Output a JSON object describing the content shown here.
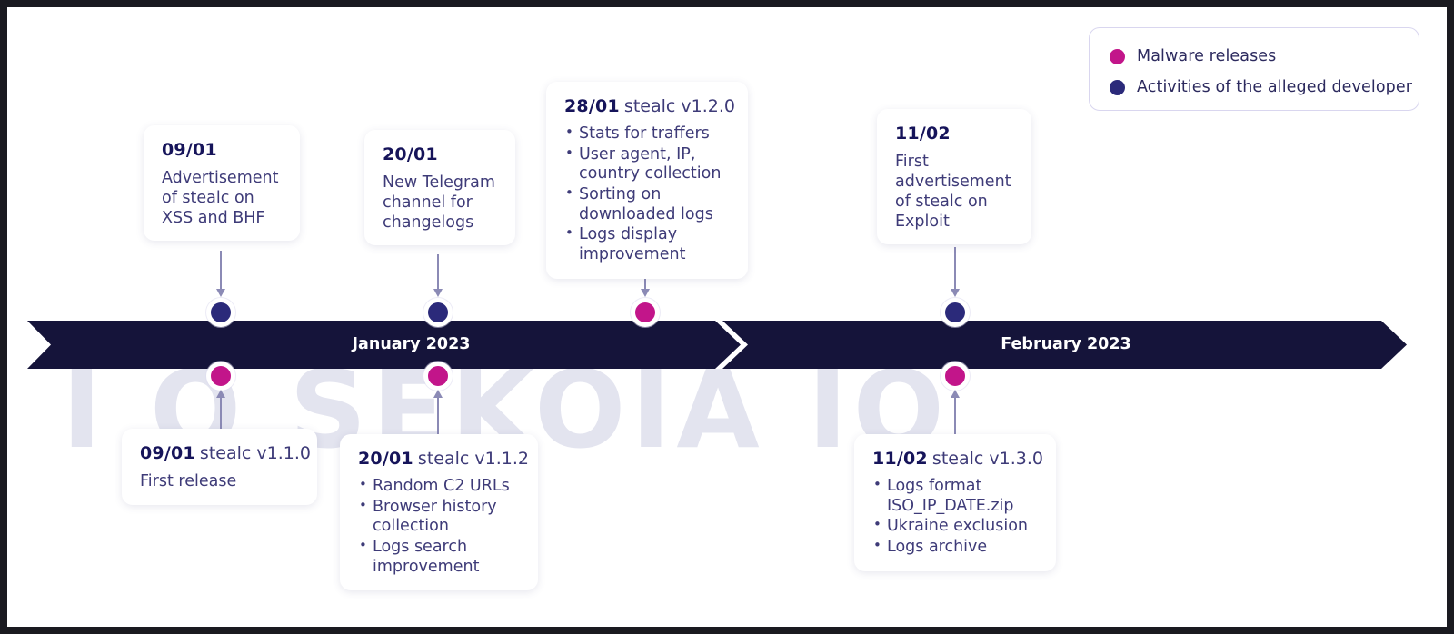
{
  "watermark": {
    "text": "I O  SEKOIA IO"
  },
  "colors": {
    "malware": "#c2158a",
    "developer": "#2b2a7a",
    "bar": "#15143a",
    "text": "#3e3b78",
    "date": "#16145a"
  },
  "legend": {
    "items": [
      {
        "label": "Malware releases",
        "color": "#c2158a",
        "icon": "dot-icon"
      },
      {
        "label": "Activities of the alleged developer",
        "color": "#2b2a7a",
        "icon": "dot-icon"
      }
    ]
  },
  "timeline": {
    "months": [
      {
        "label": "January 2023"
      },
      {
        "label": "February 2023"
      }
    ],
    "nodes": [
      {
        "date": "09/01",
        "type": "developer",
        "position": "top"
      },
      {
        "date": "20/01",
        "type": "developer",
        "position": "top"
      },
      {
        "date": "28/01",
        "type": "malware",
        "position": "top"
      },
      {
        "date": "11/02",
        "type": "developer",
        "position": "top"
      },
      {
        "date": "09/01",
        "type": "malware",
        "position": "bottom"
      },
      {
        "date": "20/01",
        "type": "malware",
        "position": "bottom"
      },
      {
        "date": "11/02",
        "type": "malware",
        "position": "bottom"
      }
    ]
  },
  "cards": {
    "top": [
      {
        "date": "09/01",
        "version": "",
        "lines": [
          "Advertisement",
          "of stealc on",
          "XSS and BHF"
        ],
        "bullets": []
      },
      {
        "date": "20/01",
        "version": "",
        "lines": [
          "New Telegram",
          "channel for",
          "changelogs"
        ],
        "bullets": []
      },
      {
        "date": "28/01",
        "version": "stealc v1.2.0",
        "lines": [],
        "bullets": [
          "Stats for traffers",
          "User agent, IP, country collection",
          "Sorting on downloaded logs",
          "Logs display improvement"
        ]
      },
      {
        "date": "11/02",
        "version": "",
        "lines": [
          "First",
          "advertisement",
          "of stealc on",
          "Exploit"
        ],
        "bullets": []
      }
    ],
    "bottom": [
      {
        "date": "09/01",
        "version": "stealc v1.1.0",
        "lines": [
          "First release"
        ],
        "bullets": []
      },
      {
        "date": "20/01",
        "version": "stealc v1.1.2",
        "lines": [],
        "bullets": [
          "Random C2 URLs",
          "Browser history collection",
          "Logs search improvement"
        ]
      },
      {
        "date": "11/02",
        "version": "stealc v1.3.0",
        "lines": [],
        "bullets": [
          "Logs format ISO_IP_DATE.zip",
          "Ukraine exclusion",
          "Logs archive"
        ]
      }
    ]
  }
}
